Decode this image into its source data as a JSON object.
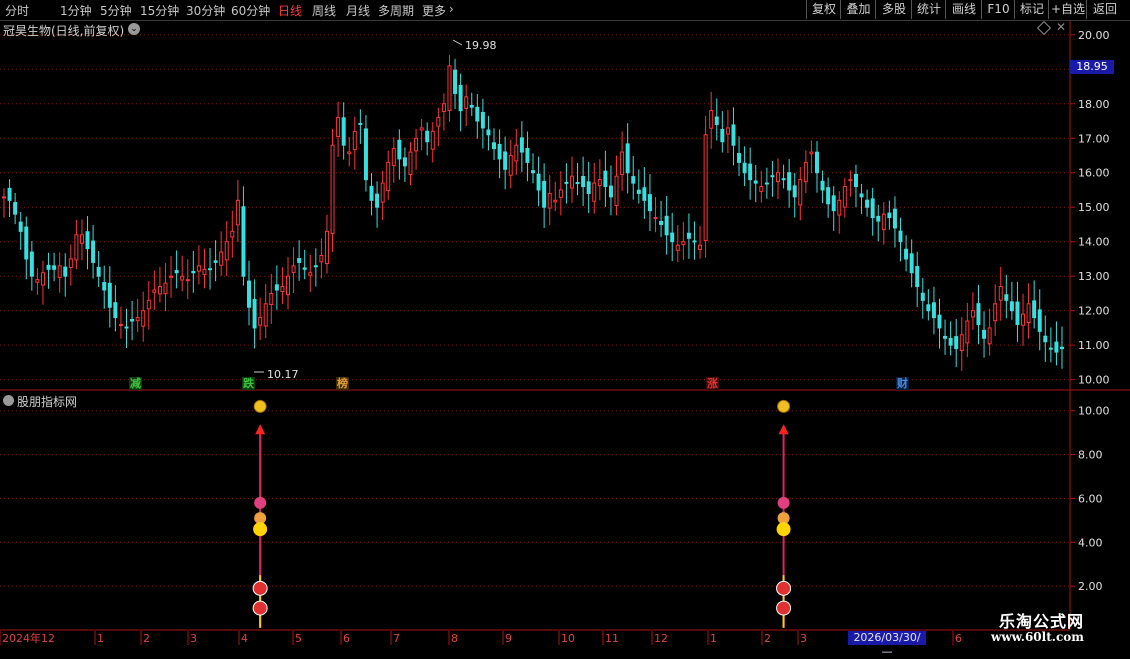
{
  "toolbar": {
    "periods": [
      {
        "label": "分时",
        "active": false
      },
      {
        "label": "1分钟",
        "active": false
      },
      {
        "label": "5分钟",
        "active": false
      },
      {
        "label": "15分钟",
        "active": false
      },
      {
        "label": "30分钟",
        "active": false
      },
      {
        "label": "60分钟",
        "active": false
      },
      {
        "label": "日线",
        "active": true
      },
      {
        "label": "周线",
        "active": false
      },
      {
        "label": "月线",
        "active": false
      },
      {
        "label": "多周期",
        "active": false
      },
      {
        "label": "更多",
        "active": false
      }
    ],
    "buttons": [
      "复权",
      "叠加",
      "多股",
      "统计",
      "画线",
      "F10",
      "标记",
      "+自选",
      "返回"
    ]
  },
  "stock": {
    "title": "冠昊生物(日线,前复权)",
    "current_price": "18.95",
    "high_label": "19.98",
    "low_label": "10.17"
  },
  "indicator": {
    "title": "股朋指标网"
  },
  "markers": [
    {
      "char": "减",
      "color": "#3ec33e"
    },
    {
      "char": "跌",
      "color": "#3ec33e"
    },
    {
      "char": "榜",
      "color": "#e0a030"
    },
    {
      "char": "涨",
      "color": "#e03030"
    },
    {
      "char": "财",
      "color": "#4a8ae0"
    }
  ],
  "date_axis": {
    "labels": [
      "2024年12",
      "1",
      "2",
      "3",
      "4",
      "5",
      "6",
      "7",
      "8",
      "9",
      "10",
      "11",
      "12",
      "1",
      "2",
      "3",
      "6"
    ],
    "cursor": "2026/03/30/—"
  },
  "watermark": {
    "title": "乐淘公式网",
    "url": "www.60lt.com"
  },
  "chart_data": {
    "type": "candlestick",
    "price_axis": {
      "ticks": [
        20.0,
        19.0,
        18.0,
        17.0,
        16.0,
        15.0,
        14.0,
        13.0,
        12.0,
        11.0,
        10.0
      ],
      "ylim": [
        9.7,
        20.4
      ]
    },
    "indicator_axis": {
      "ticks": [
        10.0,
        8.0,
        6.0,
        4.0,
        2.0
      ],
      "ylim": [
        0,
        10.9
      ]
    },
    "closes": [
      15.3,
      15.2,
      14.8,
      14.3,
      13.5,
      13.0,
      12.9,
      13.1,
      13.2,
      13.2,
      13.3,
      13.0,
      13.5,
      14.2,
      14.2,
      13.8,
      13.4,
      13.0,
      12.6,
      12.1,
      11.8,
      11.6,
      11.5,
      11.7,
      11.8,
      12.0,
      12.3,
      12.6,
      12.7,
      12.8,
      13.0,
      13.1,
      13.0,
      12.9,
      13.1,
      13.3,
      13.2,
      13.2,
      13.4,
      13.7,
      14.0,
      14.3,
      15.2,
      13.0,
      12.1,
      11.5,
      11.8,
      12.2,
      12.5,
      12.6,
      12.7,
      13.0,
      13.3,
      13.4,
      13.2,
      13.1,
      13.3,
      13.6,
      14.3,
      16.8,
      17.6,
      16.8,
      16.6,
      17.2,
      17.4,
      15.8,
      15.2,
      15.0,
      15.7,
      16.3,
      16.7,
      16.4,
      16.2,
      16.6,
      17.0,
      17.3,
      16.9,
      17.2,
      17.6,
      18.0,
      19.1,
      18.3,
      17.8,
      18.2,
      17.9,
      17.5,
      17.3,
      17.1,
      16.7,
      16.4,
      16.1,
      16.5,
      16.8,
      16.6,
      16.3,
      16.0,
      15.5,
      15.0,
      15.4,
      15.2,
      15.5,
      15.7,
      15.9,
      15.7,
      15.6,
      15.4,
      15.7,
      15.8,
      15.6,
      15.3,
      15.9,
      16.6,
      16.0,
      15.7,
      15.4,
      15.2,
      14.9,
      14.7,
      14.5,
      14.2,
      14.0,
      13.9,
      14.0,
      14.1,
      14.0,
      13.9,
      17.1,
      17.8,
      17.4,
      16.9,
      17.3,
      16.8,
      16.3,
      16.0,
      15.8,
      15.7,
      15.6,
      15.7,
      15.9,
      16.0,
      15.8,
      15.5,
      15.3,
      15.8,
      16.3,
      16.6,
      16.0,
      15.5,
      15.1,
      14.9,
      15.2,
      15.6,
      15.8,
      15.6,
      15.3,
      15.0,
      14.7,
      14.6,
      14.8,
      14.7,
      14.4,
      14.0,
      13.5,
      13.1,
      12.7,
      12.3,
      12.0,
      11.8,
      11.5,
      11.2,
      11.0,
      10.9,
      11.3,
      11.7,
      12.0,
      11.6,
      11.2,
      11.5,
      12.2,
      12.7,
      12.3,
      12.0,
      11.6,
      11.9,
      12.2,
      11.8,
      11.4,
      11.1,
      10.9,
      10.8,
      10.9
    ],
    "events": [
      {
        "index": 46,
        "value": 9.2
      },
      {
        "index": 140,
        "value": 9.2
      }
    ]
  }
}
